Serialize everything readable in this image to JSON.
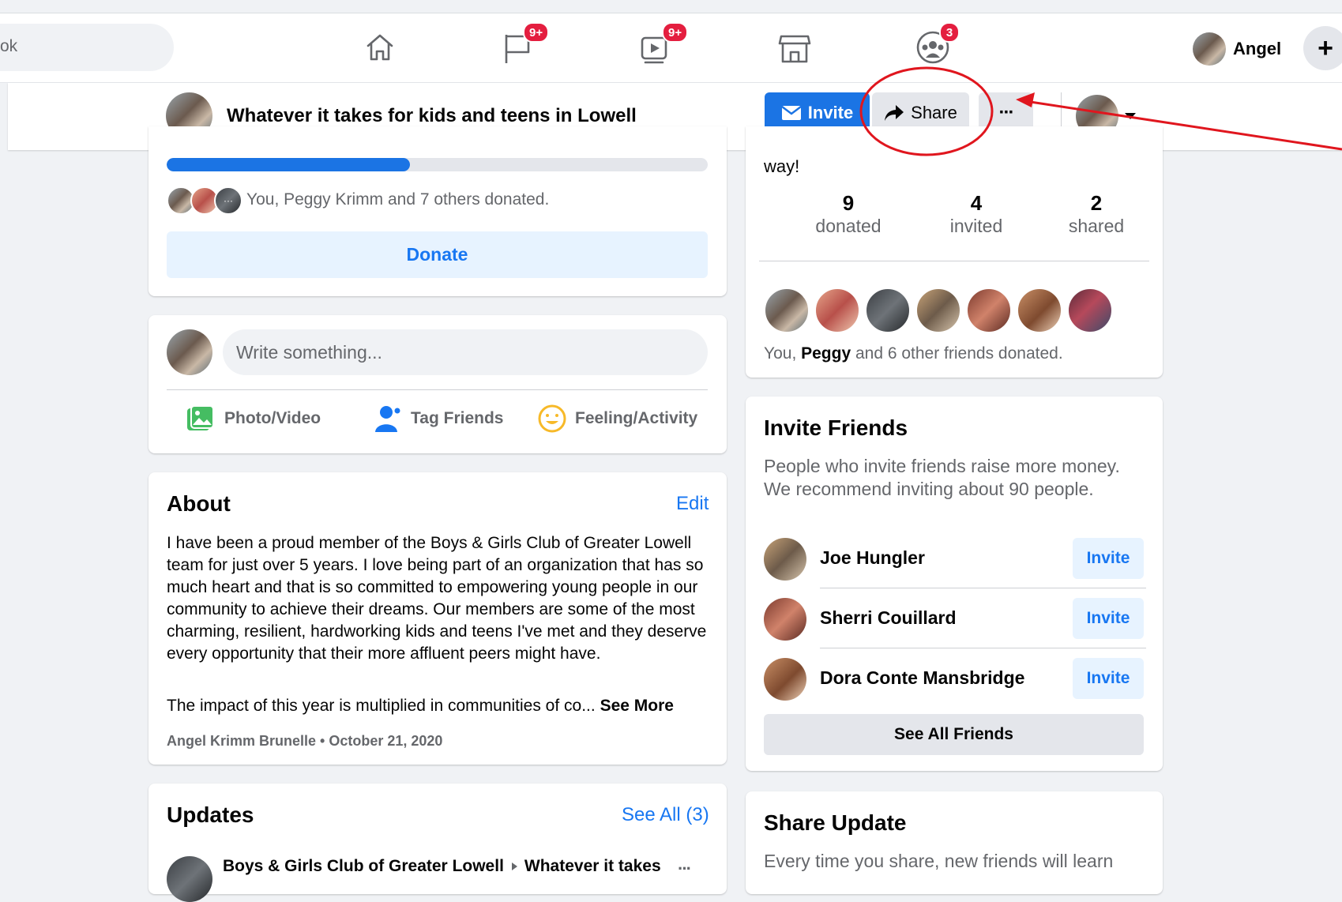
{
  "topbar": {
    "search_fragment": "ok",
    "badges": {
      "groups": "9+",
      "watch": "9+",
      "community": "3"
    },
    "user_name": "Angel",
    "plus_label": "+"
  },
  "fundraiser_header": {
    "title": "Whatever it takes for kids and teens in Lowell",
    "invite_label": "Invite",
    "share_label": "Share",
    "more_label": "···"
  },
  "donation_card": {
    "progress_fraction": 0.45,
    "donors_text": "You, Peggy Krimm and 7 others donated.",
    "donate_label": "Donate"
  },
  "composer": {
    "placeholder": "Write something...",
    "photo_label": "Photo/Video",
    "tag_label": "Tag Friends",
    "feeling_label": "Feeling/Activity"
  },
  "about": {
    "heading": "About",
    "edit_label": "Edit",
    "body": "I have been a proud member of the Boys & Girls Club of Greater Lowell team for just over 5 years. I love being part of an organization that has so much heart and that is so committed to empowering young people in our community to achieve their dreams. Our members are some of the most charming, resilient, hardworking kids and teens I've met and they deserve every opportunity that their more affluent peers might have.",
    "impact": "The impact of this year is multiplied in communities of co...",
    "see_more": "See More",
    "byline": "Angel Krimm Brunelle • October 21, 2020"
  },
  "updates": {
    "heading": "Updates",
    "see_all": "See All (3)",
    "item_org": "Boys & Girls Club of Greater Lowell",
    "item_target": "Whatever it takes",
    "more": "···"
  },
  "stats_card": {
    "top_text": "way!",
    "stats": [
      {
        "value": "9",
        "label": "donated"
      },
      {
        "value": "4",
        "label": "invited"
      },
      {
        "value": "2",
        "label": "shared"
      }
    ],
    "friends_prefix": "You, ",
    "friends_bold": "Peggy",
    "friends_suffix": " and 6 other friends donated."
  },
  "invite_friends": {
    "heading": "Invite Friends",
    "description": "People who invite friends raise more money. We recommend inviting about 90 people.",
    "friends": [
      {
        "name": "Joe Hungler",
        "action": "Invite"
      },
      {
        "name": "Sherri Couillard",
        "action": "Invite"
      },
      {
        "name": "Dora Conte Mansbridge",
        "action": "Invite"
      }
    ],
    "see_all": "See All Friends"
  },
  "share_update": {
    "heading": "Share Update",
    "description": "Every time you share, new friends will learn"
  },
  "colors": {
    "facebook_blue": "#1877f2",
    "annotation_red": "#e0161e",
    "badge_red": "#e41e3f"
  }
}
